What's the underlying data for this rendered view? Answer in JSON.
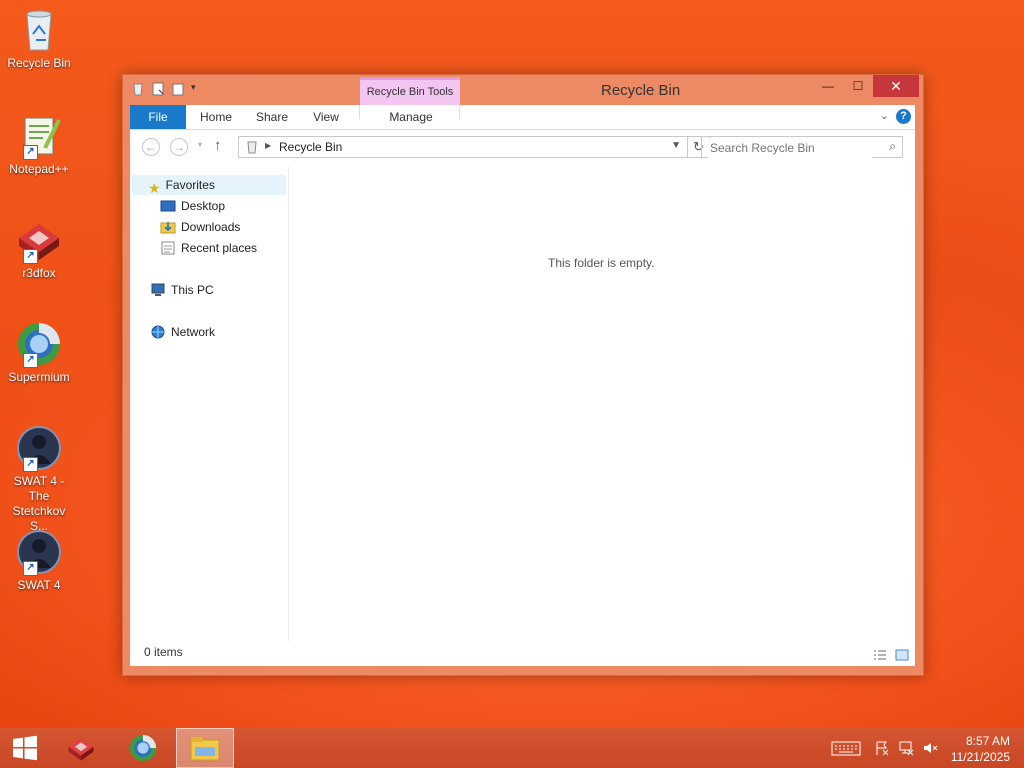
{
  "desktop": {
    "icons": [
      {
        "label": "Recycle Bin"
      },
      {
        "label": "Notepad++"
      },
      {
        "label": "r3dfox"
      },
      {
        "label": "Supermium"
      },
      {
        "label": "SWAT 4 - The Stetchkov S..."
      },
      {
        "label": "SWAT 4"
      }
    ]
  },
  "window": {
    "title": "Recycle Bin",
    "context_tab": "Recycle Bin Tools",
    "tabs": [
      "File",
      "Home",
      "Share",
      "View",
      "Manage"
    ],
    "address": "Recycle Bin",
    "search_placeholder": "Search Recycle Bin",
    "nav": {
      "favorites": "Favorites",
      "favorites_items": [
        "Desktop",
        "Downloads",
        "Recent places"
      ],
      "this_pc": "This PC",
      "network": "Network"
    },
    "empty_message": "This folder is empty.",
    "status": "0 items"
  },
  "taskbar": {
    "time": "8:57 AM",
    "date": "11/21/2025"
  },
  "colors": {
    "accent": "#1979ca",
    "window_frame": "#ee8a63",
    "context_tab": "#f2c6f0",
    "close_button": "#c7363b",
    "taskbar": "#cf4e2a"
  }
}
